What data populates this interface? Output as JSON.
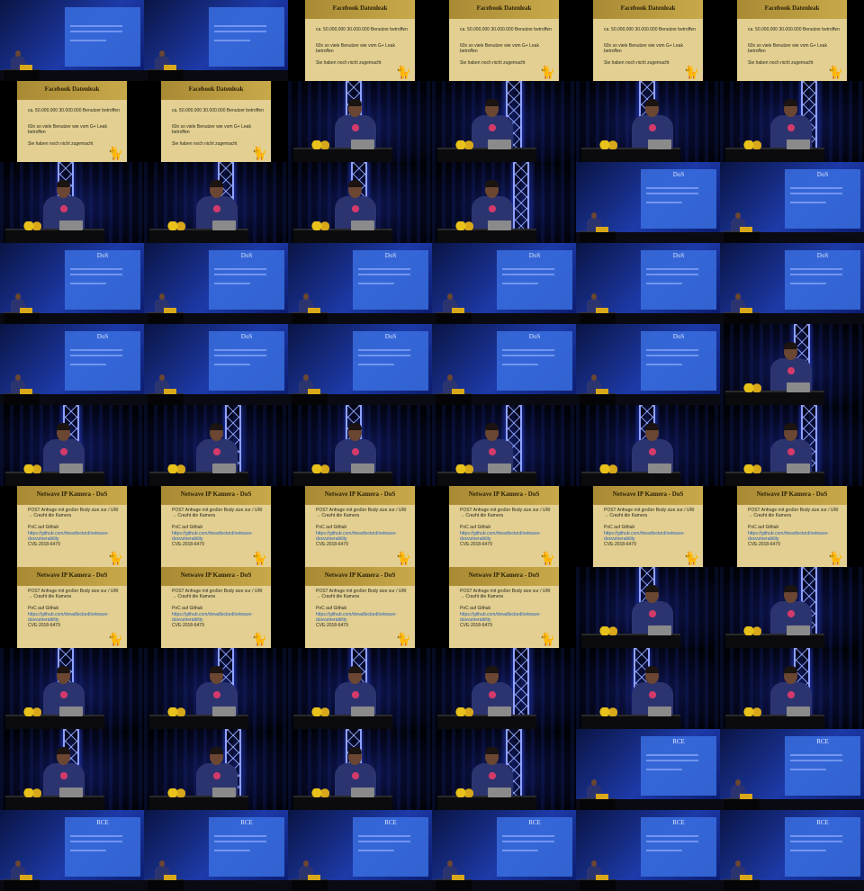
{
  "slides": {
    "facebook": {
      "title": "Facebook Datenleak",
      "lines": [
        "ca. 50.000.000 30.000.000 Benutzer betroffen",
        "60x so viele Benutzer wie vom G+ Leak betroffen",
        "Sie haben noch nicht zugemacht"
      ]
    },
    "netwave": {
      "title": "Netwave IP Kamera - DoS",
      "lines": [
        "POST Anfrage mit großer Body size zur / URI → Crasht die Kamera",
        "PoC auf Github",
        "https://github.com/dreadlocked/netwave-dosvulnerability",
        "CVE-2018-6479"
      ]
    },
    "dos": {
      "title": "DoS"
    },
    "rce": {
      "title": "RCE"
    }
  },
  "frames": [
    "proj-light",
    "proj-light",
    "facebook",
    "facebook",
    "facebook",
    "facebook",
    "facebook",
    "facebook",
    "stage",
    "stage",
    "stage",
    "stage",
    "stage",
    "stage",
    "stage",
    "stage",
    "proj-dos",
    "proj-dos",
    "proj-dos",
    "proj-dos",
    "proj-dos",
    "proj-dos",
    "proj-dos",
    "proj-dos",
    "proj-dos",
    "proj-dos",
    "proj-dos",
    "proj-dos",
    "proj-dos",
    "stage",
    "stage",
    "stage",
    "stage",
    "stage",
    "stage",
    "stage",
    "netwave",
    "netwave",
    "netwave",
    "netwave",
    "netwave",
    "netwave",
    "netwave",
    "netwave",
    "netwave",
    "netwave",
    "stage",
    "stage",
    "stage",
    "stage",
    "stage",
    "stage",
    "stage",
    "stage",
    "stage",
    "stage",
    "stage",
    "stage",
    "proj-rce",
    "proj-rce",
    "proj-rce",
    "proj-rce",
    "proj-rce",
    "proj-rce",
    "proj-rce",
    "proj-rce"
  ]
}
